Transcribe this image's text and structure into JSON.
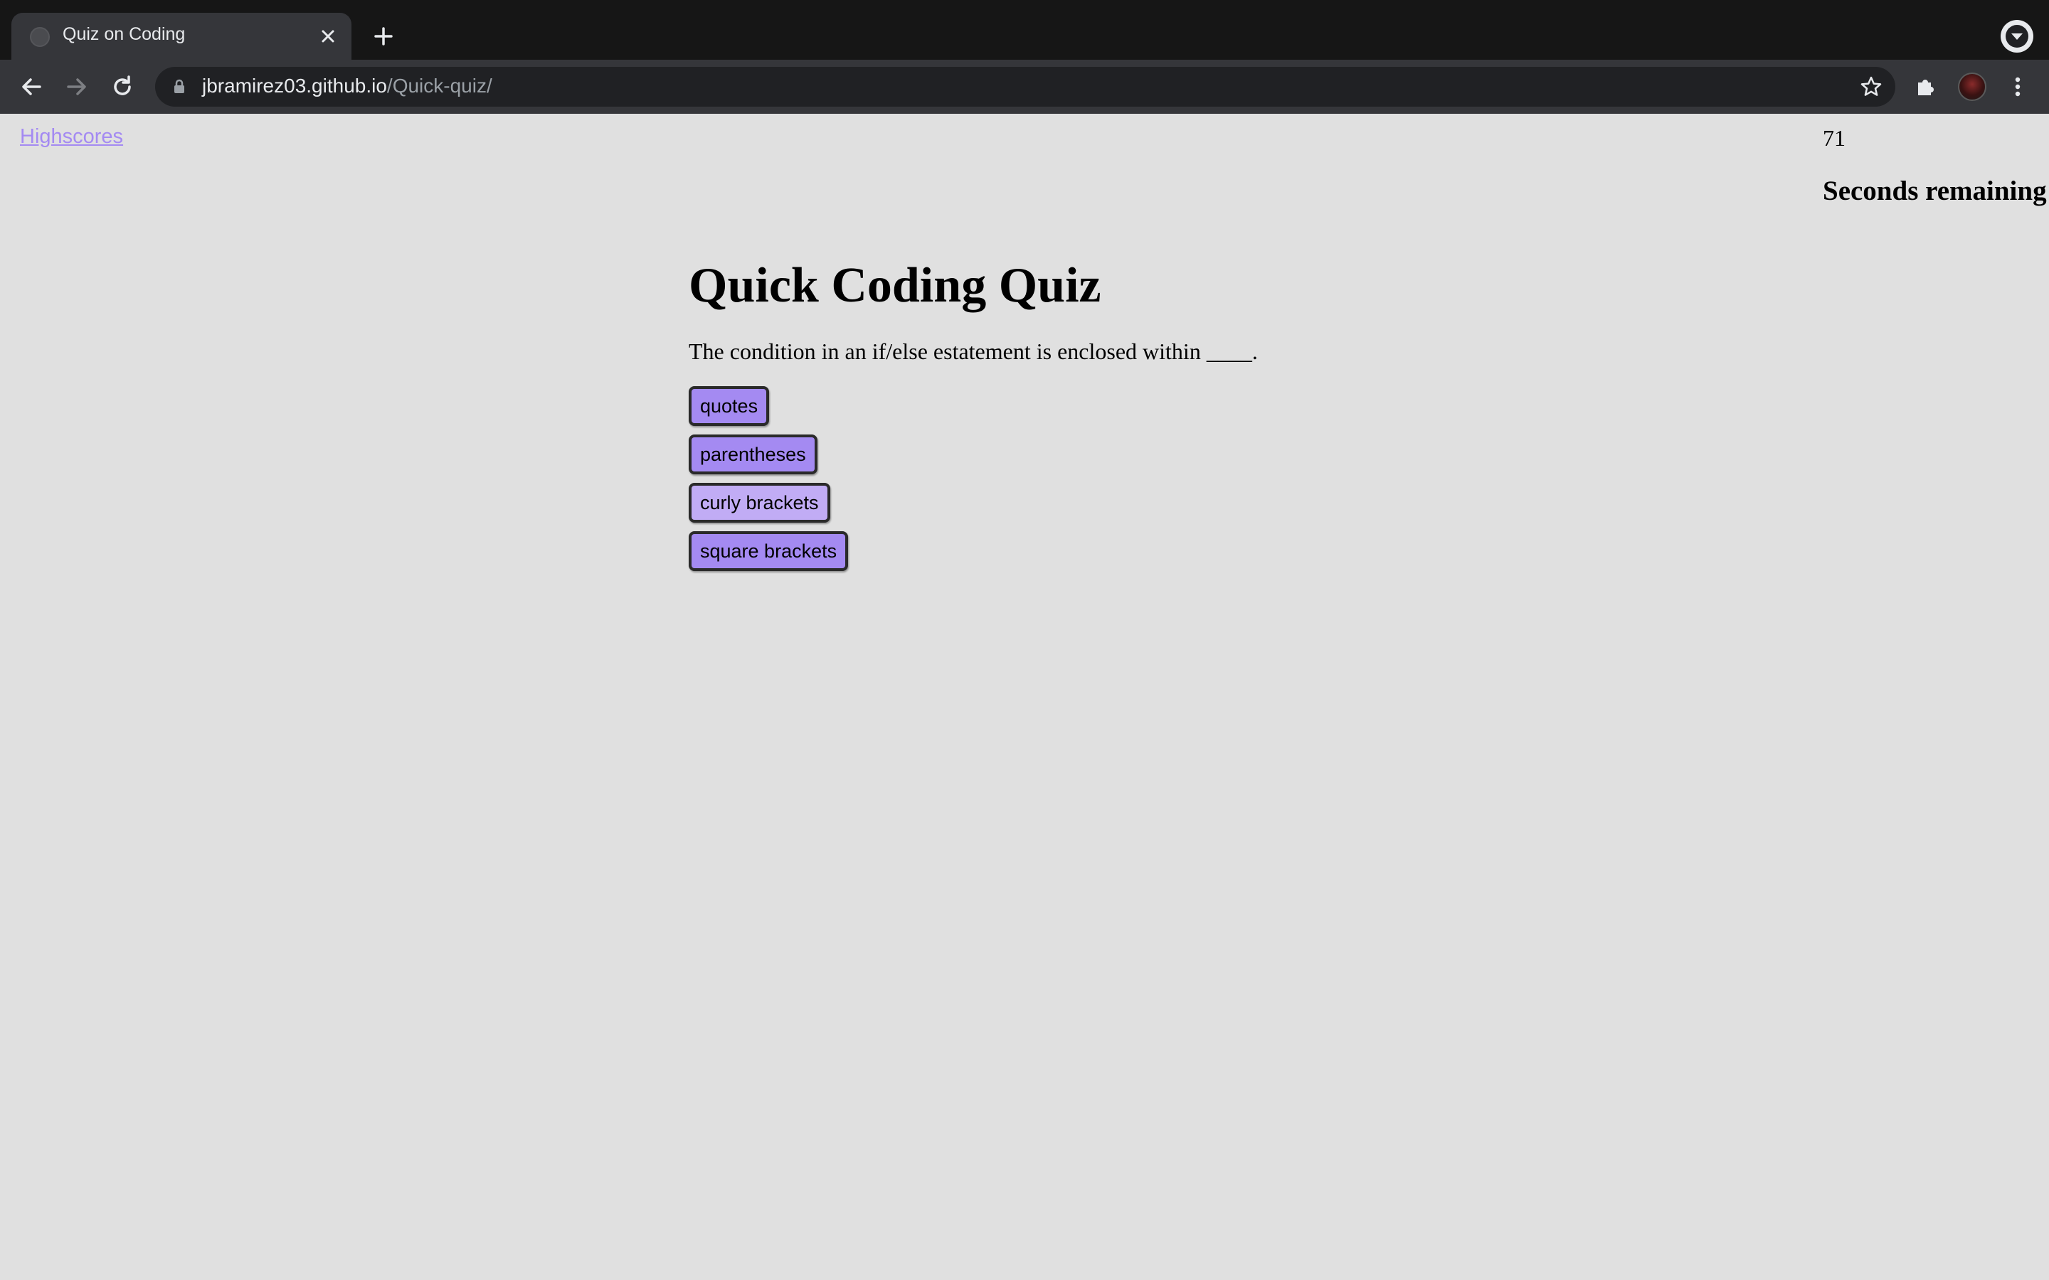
{
  "browser": {
    "tab_title": "Quiz on Coding",
    "url_host": "jbramirez03.github.io",
    "url_path": "/Quick-quiz/"
  },
  "page": {
    "highscores_link": "Highscores",
    "timer_value": "71",
    "timer_label": "Seconds remaining",
    "title": "Quick Coding Quiz",
    "question": "The condition in an if/else estatement is enclosed within ____.",
    "answers": [
      {
        "label": "quotes"
      },
      {
        "label": "parentheses"
      },
      {
        "label": "curly brackets"
      },
      {
        "label": "square brackets"
      }
    ]
  },
  "colors": {
    "page_background": "#e0e0e0",
    "accent": "#a48af2",
    "answer_hover": "#c1acf5",
    "chrome_dark": "#202124"
  },
  "icons": {
    "tab_close": "close-icon",
    "new_tab": "plus-icon",
    "back": "arrow-left-icon",
    "forward": "arrow-right-icon",
    "reload": "reload-icon",
    "lock": "lock-icon",
    "bookmark": "star-icon",
    "extensions": "puzzle-icon",
    "menu": "kebab-menu-icon",
    "tab_search": "chevron-down-icon"
  }
}
